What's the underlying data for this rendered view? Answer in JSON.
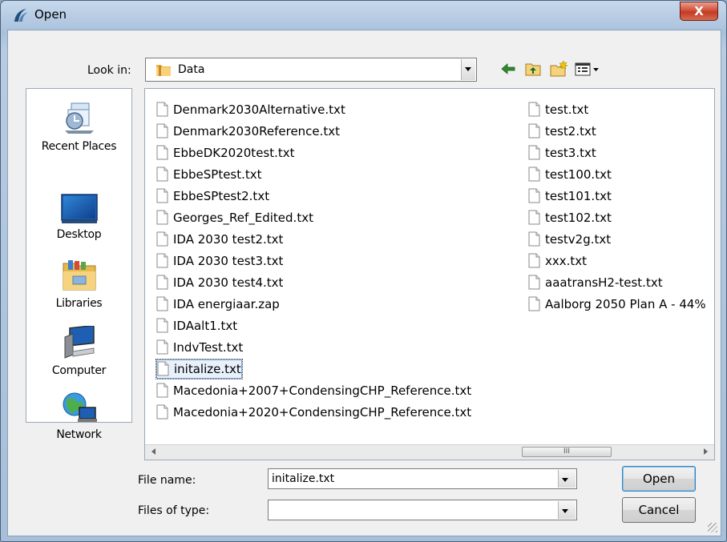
{
  "window": {
    "title": "Open",
    "close_label": "X"
  },
  "toolbar": {
    "look_in_label": "Look in:",
    "look_in_value": "Data",
    "icons": [
      "back-arrow-icon",
      "up-folder-icon",
      "new-folder-icon",
      "view-menu-icon"
    ]
  },
  "places": [
    {
      "label": "Recent Places",
      "icon": "recent-places-icon"
    },
    {
      "label": "Desktop",
      "icon": "desktop-icon"
    },
    {
      "label": "Libraries",
      "icon": "libraries-icon"
    },
    {
      "label": "Computer",
      "icon": "computer-icon"
    },
    {
      "label": "Network",
      "icon": "network-icon"
    }
  ],
  "files": {
    "column1": [
      "Denmark2030Alternative.txt",
      "Denmark2030Reference.txt",
      "EbbeDK2020test.txt",
      "EbbeSPtest.txt",
      "EbbeSPtest2.txt",
      "Georges_Ref_Edited.txt",
      "IDA 2030 test2.txt",
      "IDA 2030 test3.txt",
      "IDA 2030 test4.txt",
      "IDA energiaar.zap",
      "IDAalt1.txt",
      "IndvTest.txt",
      "initalize.txt",
      "Macedonia+2007+CondensingCHP_Reference.txt",
      "Macedonia+2020+CondensingCHP_Reference.txt"
    ],
    "column2": [
      "test.txt",
      "test2.txt",
      "test3.txt",
      "test100.txt",
      "test101.txt",
      "test102.txt",
      "testv2g.txt",
      "xxx.txt",
      "aaatransH2-test.txt",
      "Aalborg 2050 Plan A - 44%"
    ],
    "selected": "initalize.txt",
    "scroll_thumb_glyph": "III"
  },
  "form": {
    "file_name_label": "File name:",
    "file_name_value": "initalize.txt",
    "files_of_type_label": "Files of type:",
    "files_of_type_value": ""
  },
  "buttons": {
    "open": "Open",
    "cancel": "Cancel"
  },
  "colors": {
    "selection": "#e8f1fb",
    "close": "#c43a22",
    "frame": "#a9c1dc"
  }
}
